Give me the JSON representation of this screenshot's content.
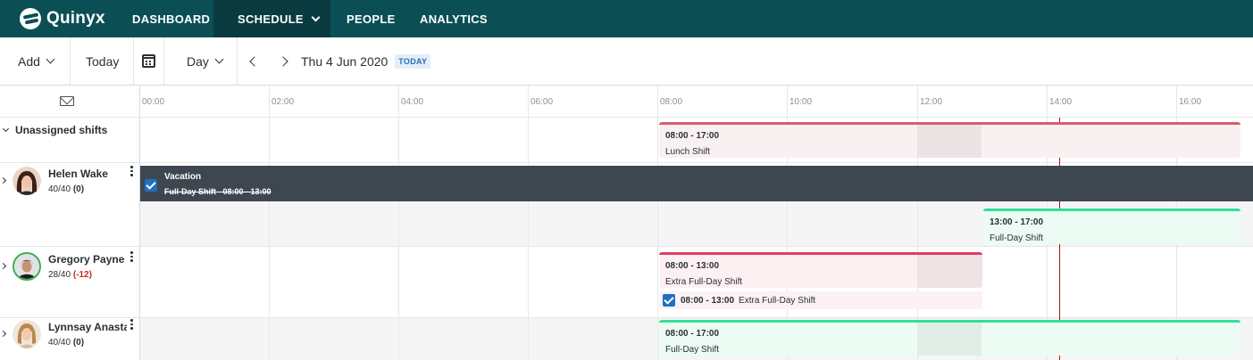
{
  "nav": {
    "brand": "Quinyx",
    "items": [
      {
        "label": "DASHBOARD"
      },
      {
        "label": "SCHEDULE"
      },
      {
        "label": "PEOPLE"
      },
      {
        "label": "ANALYTICS"
      }
    ],
    "active": "SCHEDULE"
  },
  "toolbar": {
    "add_label": "Add",
    "today_label": "Today",
    "view_label": "Day",
    "date_label": "Thu 4 Jun 2020",
    "today_badge": "TODAY"
  },
  "timeline": {
    "hours": [
      "00:00",
      "02:00",
      "04:00",
      "06:00",
      "08:00",
      "10:00",
      "12:00",
      "14:00",
      "16:00"
    ]
  },
  "unassigned": {
    "label": "Unassigned shifts",
    "shift": {
      "time": "08:00 - 17:00",
      "name": "Lunch Shift"
    }
  },
  "employees": [
    {
      "name": "Helen Wake",
      "hours_ratio": "40/40",
      "hours_diff": "(0)",
      "absence": {
        "title": "Vacation",
        "detail": "Full-Day Shift",
        "detail_time": "08:00 - 13:00"
      },
      "shift": {
        "time": "13:00 - 17:00",
        "name": "Full-Day Shift"
      }
    },
    {
      "name": "Gregory Payne",
      "hours_ratio": "28/40",
      "hours_diff": "(-12)",
      "shift": {
        "time": "08:00 - 13:00",
        "name": "Extra Full-Day Shift"
      },
      "task": {
        "time": "08:00 - 13:00",
        "name": "Extra Full-Day Shift"
      }
    },
    {
      "name": "Lynnsay Anasta",
      "hours_ratio": "40/40",
      "hours_diff": "(0)",
      "shift": {
        "time": "08:00 - 17:00",
        "name": "Full-Day Shift"
      }
    }
  ],
  "colors": {
    "nav_bg": "#0b4f55",
    "nav_active": "#083a3f",
    "lunch_shift_accent": "#d45f6b",
    "extra_shift_accent": "#e33b66",
    "full_day_shift_accent": "#2fe097",
    "vacation_bg": "#3e4750",
    "now_line": "#a01818",
    "negative_diff": "#c62828"
  }
}
